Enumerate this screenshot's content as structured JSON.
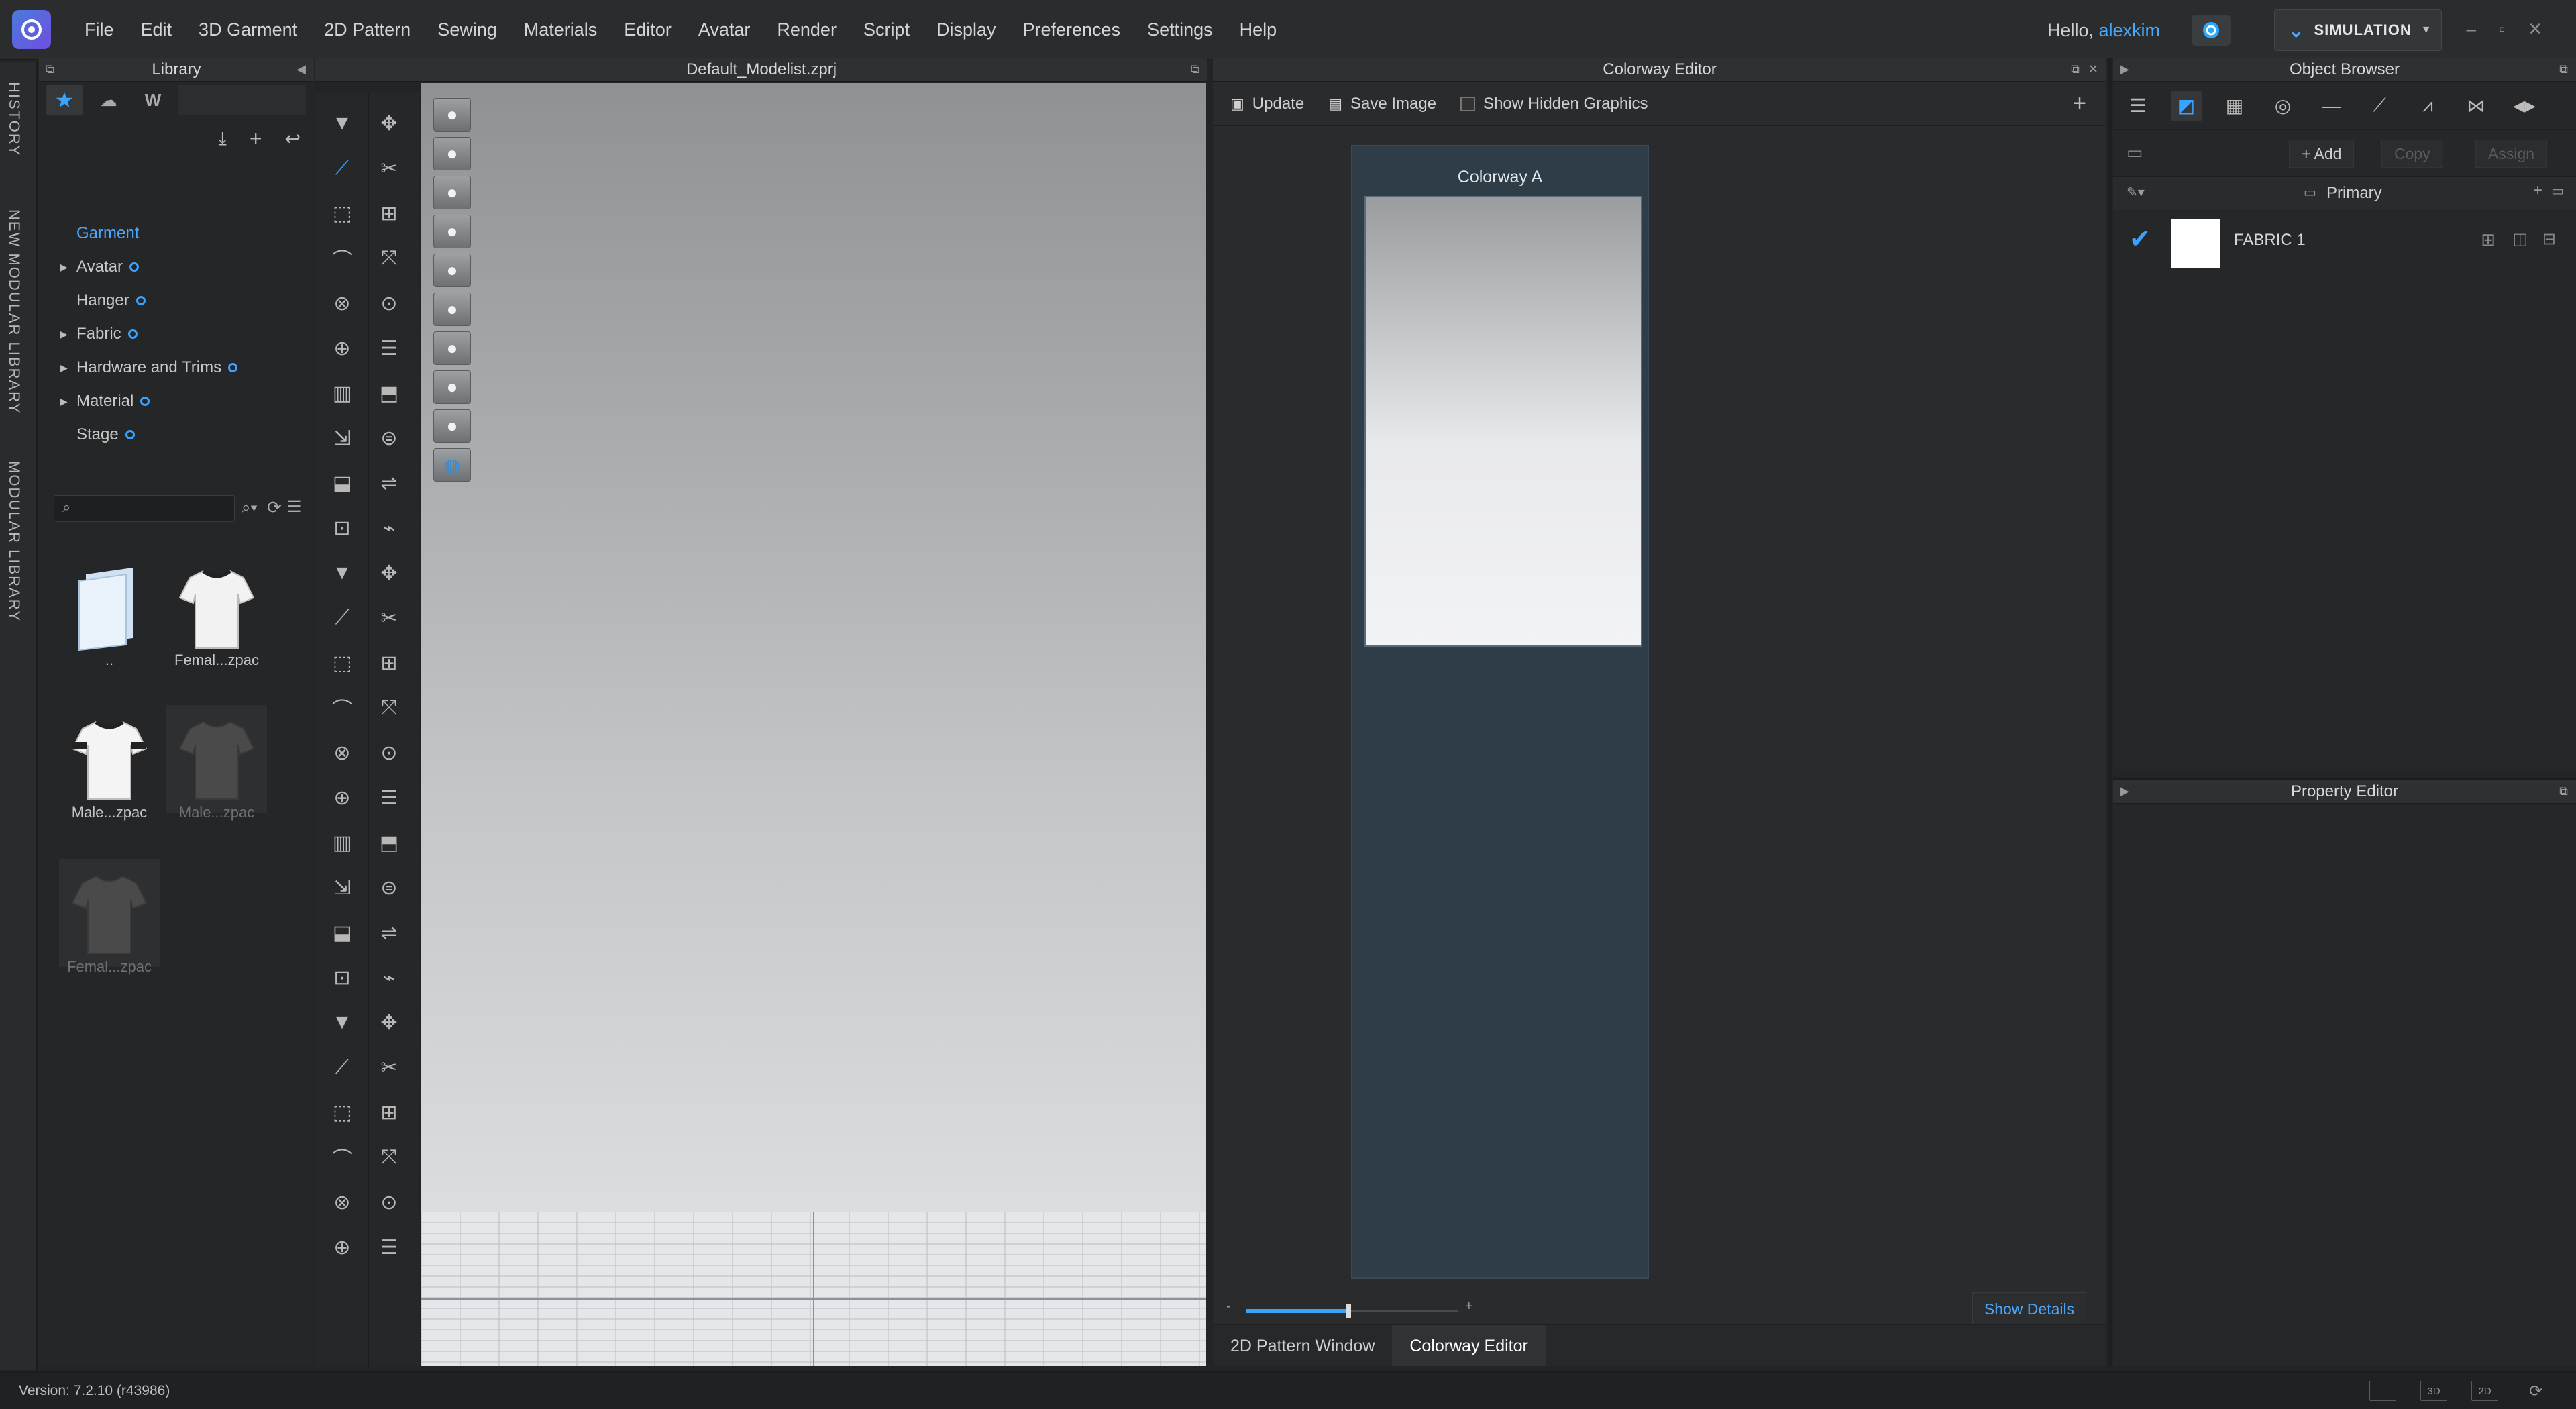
{
  "menubar": {
    "items": [
      "File",
      "Edit",
      "3D Garment",
      "2D Pattern",
      "Sewing",
      "Materials",
      "Editor",
      "Avatar",
      "Render",
      "Script",
      "Display",
      "Preferences",
      "Settings",
      "Help"
    ],
    "greeting_prefix": "Hello, ",
    "username": "alexkim",
    "mode_label": "SIMULATION",
    "window_controls": [
      "–",
      "▫",
      "✕"
    ]
  },
  "vertical_tabs": [
    "HISTORY",
    "NEW MODULAR LIBRARY",
    "MODULAR LIBRARY"
  ],
  "library": {
    "title": "Library",
    "tree": [
      {
        "label": "Garment",
        "selected": true,
        "expandable": false
      },
      {
        "label": "Avatar",
        "expandable": true
      },
      {
        "label": "Hanger",
        "expandable": false
      },
      {
        "label": "Fabric",
        "expandable": true
      },
      {
        "label": "Hardware and Trims",
        "expandable": true
      },
      {
        "label": "Material",
        "expandable": true
      },
      {
        "label": "Stage",
        "expandable": false
      }
    ],
    "search_placeholder": "",
    "thumbnails": [
      {
        "label": "..",
        "dim": false
      },
      {
        "label": "Femal...zpac",
        "dim": false
      },
      {
        "label": "Male...zpac",
        "dim": false
      },
      {
        "label": "Male...zpac",
        "dim": true
      },
      {
        "label": "Femal...zpac",
        "dim": true
      }
    ]
  },
  "viewport": {
    "title": "Default_Modelist.zprj"
  },
  "colorway_editor": {
    "title": "Colorway Editor",
    "update_label": "Update",
    "save_image_label": "Save Image",
    "show_hidden_label": "Show Hidden Graphics",
    "colorway_name": "Colorway A",
    "slider_min_label": "-",
    "slider_max_label": "+",
    "zoom_level": 0.48,
    "show_details_label": "Show Details"
  },
  "bottom_tabs": [
    {
      "label": "2D Pattern Window",
      "active": false
    },
    {
      "label": "Colorway Editor",
      "active": true
    }
  ],
  "object_browser": {
    "title": "Object Browser",
    "add_label": "+ Add",
    "copy_label": "Copy",
    "assign_label": "Assign",
    "group_label": "Primary",
    "fabric_name": "FABRIC 1"
  },
  "property_editor": {
    "title": "Property Editor"
  },
  "status": {
    "version": "Version: 7.2.10 (r43986)",
    "view_modes": [
      "",
      "3D",
      "2D",
      "⟳"
    ]
  },
  "colors": {
    "accent": "#4aa8ff",
    "colorway_card": "#2f3d49",
    "panel_bg": "#262729"
  }
}
